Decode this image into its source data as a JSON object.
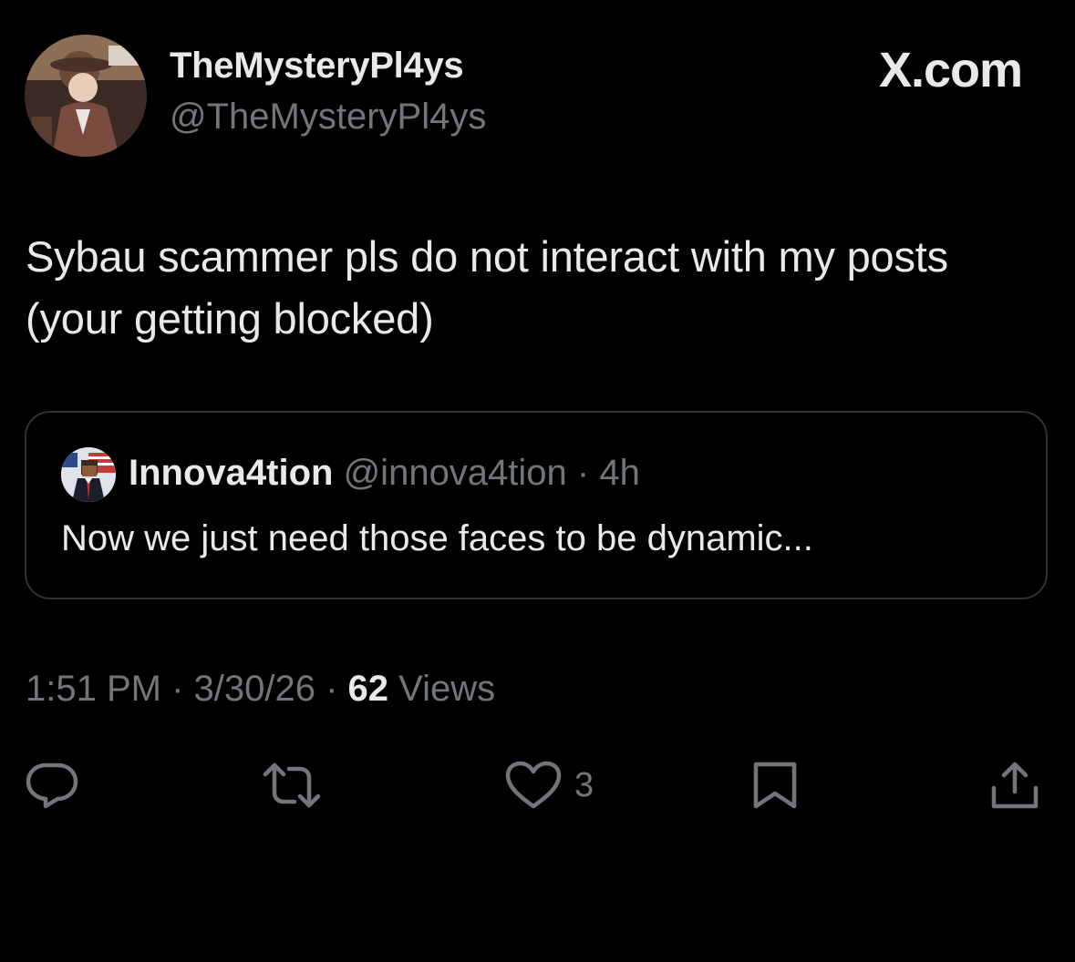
{
  "author": {
    "display_name": "TheMysteryPl4ys",
    "handle": "@TheMysteryPl4ys"
  },
  "brand": "X.com",
  "tweet": {
    "text_line1": "Sybau scammer pls do not interact with my posts",
    "text_line2": "(your getting blocked)"
  },
  "quote": {
    "display_name": "Innova4tion",
    "handle": "@innova4tion",
    "separator": " · ",
    "age": "4h",
    "text": "Now we just need those faces to be dynamic..."
  },
  "meta": {
    "time": "1:51 PM",
    "sep1": " · ",
    "date": "3/30/26",
    "sep2": " · ",
    "views_count": "62",
    "views_label": " Views"
  },
  "actions": {
    "reply_icon": "reply-icon",
    "repost_icon": "repost-icon",
    "like_icon": "heart-icon",
    "like_count": "3",
    "bookmark_icon": "bookmark-icon",
    "share_icon": "share-icon"
  },
  "colors": {
    "background": "#000000",
    "text_primary": "#e7e9ea",
    "text_secondary": "#71767b",
    "border": "#2f3336"
  }
}
